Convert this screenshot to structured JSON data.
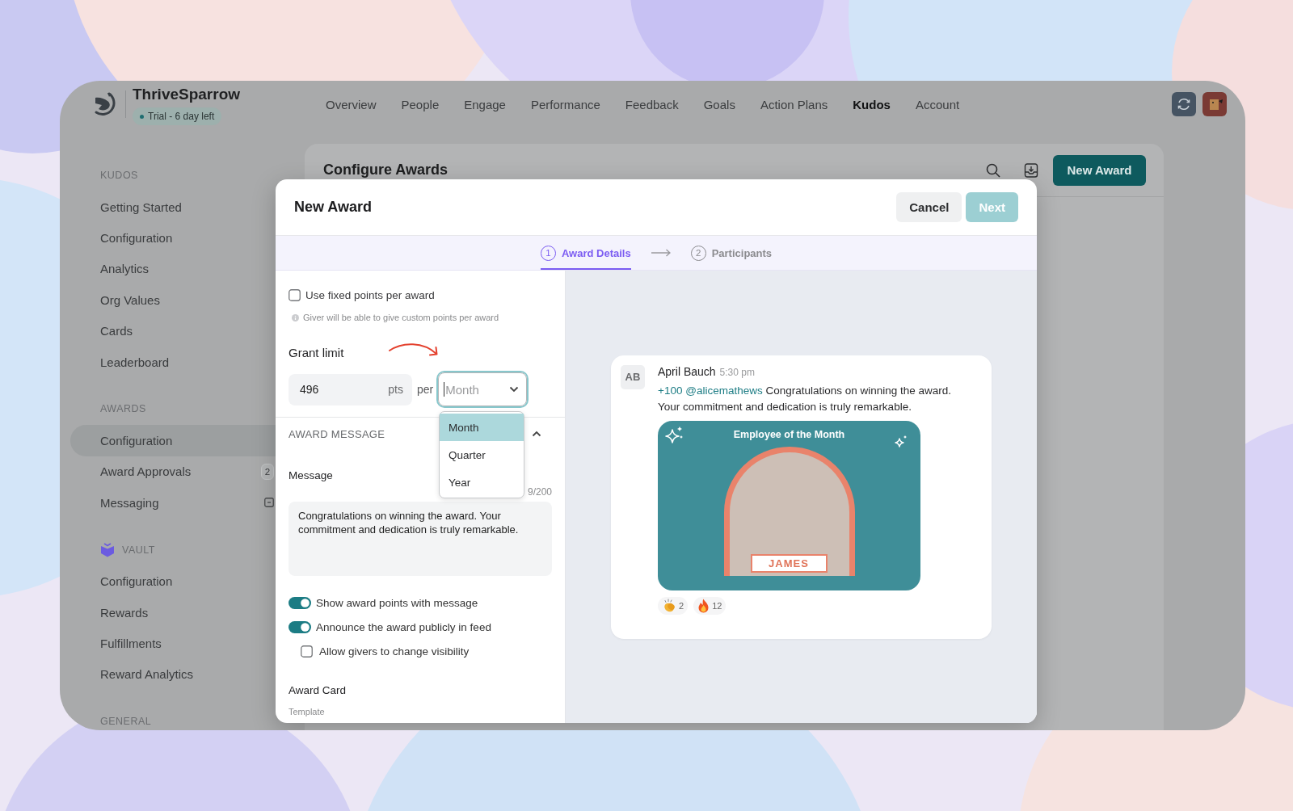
{
  "header": {
    "brand": "ThriveSparrow",
    "trial": "Trial - 6 day left",
    "nav": [
      {
        "label": "Overview",
        "selected": false
      },
      {
        "label": "People",
        "selected": false
      },
      {
        "label": "Engage",
        "selected": false
      },
      {
        "label": "Performance",
        "selected": false
      },
      {
        "label": "Feedback",
        "selected": false
      },
      {
        "label": "Goals",
        "selected": false
      },
      {
        "label": "Action Plans",
        "selected": false
      },
      {
        "label": "Kudos",
        "selected": true
      },
      {
        "label": "Account",
        "selected": false
      }
    ]
  },
  "sidebar": {
    "sections": [
      {
        "title": "KUDOS",
        "items": [
          {
            "label": "Getting Started",
            "selected": false
          },
          {
            "label": "Configuration",
            "selected": false
          },
          {
            "label": "Analytics",
            "selected": false
          },
          {
            "label": "Org Values",
            "selected": false
          },
          {
            "label": "Cards",
            "selected": false
          },
          {
            "label": "Leaderboard",
            "selected": false
          }
        ]
      },
      {
        "title": "AWARDS",
        "items": [
          {
            "label": "Configuration",
            "selected": true
          },
          {
            "label": "Award Approvals",
            "selected": false,
            "badge": "2"
          },
          {
            "label": "Messaging",
            "selected": false,
            "trailing_icon": true
          }
        ]
      },
      {
        "title": "VAULT",
        "icon": true,
        "items": [
          {
            "label": "Configuration",
            "selected": false
          },
          {
            "label": "Rewards",
            "selected": false
          },
          {
            "label": "Fulfillments",
            "selected": false
          },
          {
            "label": "Reward Analytics",
            "selected": false
          }
        ]
      },
      {
        "title": "GENERAL"
      }
    ]
  },
  "page": {
    "title": "Configure Awards",
    "new_button": "New Award"
  },
  "modal": {
    "title": "New Award",
    "buttons": [
      {
        "label": "Cancel",
        "kind": "secondary",
        "disabled": false
      },
      {
        "label": "Next",
        "kind": "primary",
        "disabled": true
      }
    ],
    "steps": [
      {
        "number": "1",
        "label": "Award Details",
        "selected": true
      },
      {
        "number": "2",
        "label": "Participants",
        "selected": false
      }
    ],
    "form": {
      "fixed_points": {
        "label": "Use fixed points per award",
        "checked": false,
        "hint": "Giver will be able to give custom points per award"
      },
      "grant_limit": {
        "label": "Grant limit",
        "value": "496",
        "unit": "pts",
        "per": "per",
        "period": {
          "placeholder": "Month",
          "focused": true,
          "expanded": true,
          "options": [
            {
              "label": "Month",
              "selected": true
            },
            {
              "label": "Quarter",
              "selected": false
            },
            {
              "label": "Year",
              "selected": false
            }
          ]
        }
      },
      "award_message": {
        "title": "AWARD MESSAGE",
        "expanded": true,
        "message_label": "Message",
        "counter": "9/200",
        "message": "Congratulations on winning the award. Your commitment and dedication is truly remarkable.",
        "options": [
          {
            "kind": "toggle",
            "label": "Show award points with message",
            "checked": true
          },
          {
            "kind": "toggle",
            "label": "Announce the award publicly in feed",
            "checked": true
          },
          {
            "kind": "checkbox",
            "label": "Allow givers to change visibility",
            "checked": false
          }
        ]
      },
      "award_card": {
        "title": "Award Card",
        "template_label": "Template"
      }
    },
    "preview": {
      "avatar": "AB",
      "author": "April Bauch",
      "time": "5:30 pm",
      "points": "+100",
      "mention": "@alicemathews",
      "text": "Congratulations on winning the award. Your commitment and dedication is truly remarkable.",
      "card": {
        "title": "Employee of the Month",
        "name": "JAMES"
      },
      "reactions": [
        {
          "kind": "clap",
          "count": "2"
        },
        {
          "kind": "fire",
          "count": "12"
        }
      ]
    }
  }
}
